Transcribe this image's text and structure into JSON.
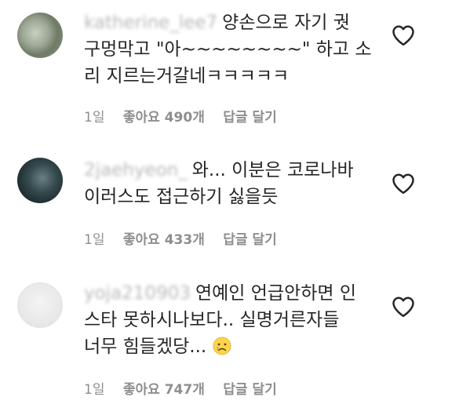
{
  "comments": [
    {
      "username": "katherine_lee7",
      "lines": [
        "양손으로 자기 궛",
        "구멍막고 \"아~~~~~~~~\" 하고 소",
        "리 지르는거갈네ㅋㅋㅋㅋㅋ"
      ],
      "time": "1일",
      "likes": "좋아요 490개",
      "reply": "답글 달기",
      "heart_icon": "heart-outline-icon"
    },
    {
      "username": "2jaehyeon_",
      "lines": [
        "와... 이분은 코로나바",
        "이러스도 접근하기 싫을듯"
      ],
      "time": "1일",
      "likes": "좋아요 433개",
      "reply": "답글 달기",
      "heart_icon": "heart-outline-icon"
    },
    {
      "username": "yoja210903",
      "lines": [
        "연예인 언급안하면 인",
        "스타 못하시나보다.. 실명거른자들",
        "너무 힘들겠당..."
      ],
      "emoji": "crying-face-emoji",
      "time": "1일",
      "likes": "좋아요 747개",
      "reply": "답글 달기",
      "heart_icon": "heart-outline-icon"
    }
  ]
}
